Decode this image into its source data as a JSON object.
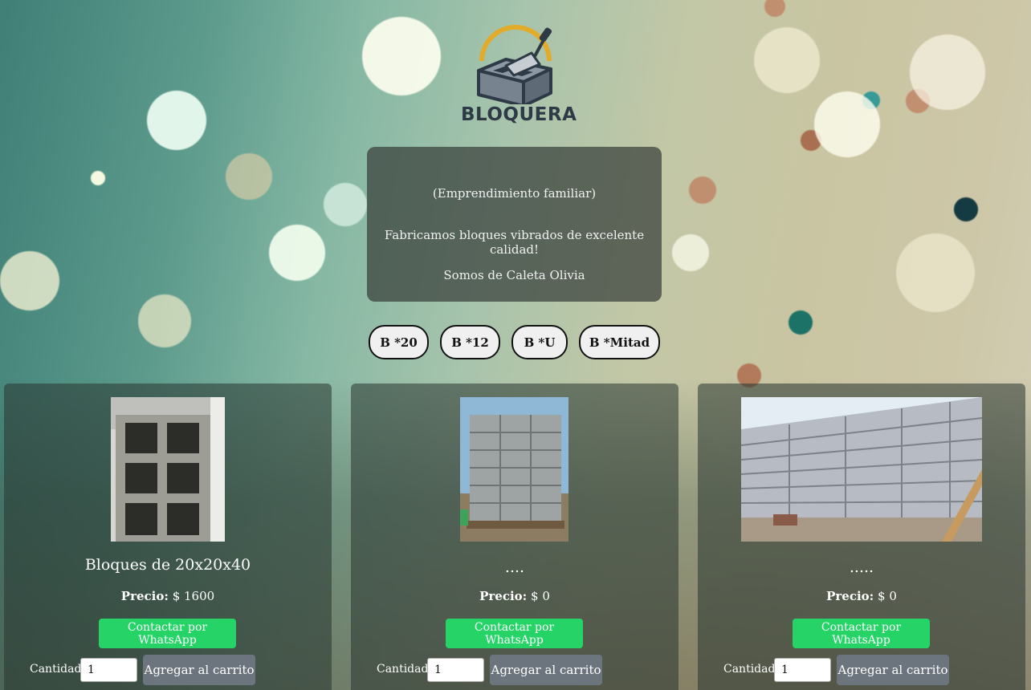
{
  "brand": {
    "name": "BLOQUERA",
    "logo_icon": "brick-trowel-logo-icon"
  },
  "intro": {
    "line1": "(Emprendimiento familiar)",
    "line2": "Fabricamos bloques vibrados de excelente calidad!",
    "line3": "Somos de Caleta Olivia"
  },
  "filters": [
    {
      "label": "B *20"
    },
    {
      "label": "B *12"
    },
    {
      "label": "B *U"
    },
    {
      "label": "B *Mitad"
    }
  ],
  "products": [
    {
      "title": "Bloques de 20x20x40",
      "price_label": "Precio:",
      "price": "$ 1600",
      "whatsapp_label": "Contactar por WhatsApp",
      "qty_label": "Cantidad:",
      "qty_value": "1",
      "add_label": "Agregar al carrito",
      "image": "concrete-block-photo"
    },
    {
      "title": "....",
      "price_label": "Precio:",
      "price": "$ 0",
      "whatsapp_label": "Contactar por WhatsApp",
      "qty_label": "Cantidad:",
      "qty_value": "1",
      "add_label": "Agregar al carrito",
      "image": "block-pallet-photo"
    },
    {
      "title": ".....",
      "price_label": "Precio:",
      "price": "$ 0",
      "whatsapp_label": "Contactar por WhatsApp",
      "qty_label": "Cantidad:",
      "qty_value": "1",
      "add_label": "Agregar al carrito",
      "image": "block-wall-photo"
    }
  ],
  "colors": {
    "whatsapp": "#25d366",
    "cart_button": "#6c757d",
    "logo_dark": "#2e3a46",
    "logo_gold": "#e3ab2b"
  }
}
